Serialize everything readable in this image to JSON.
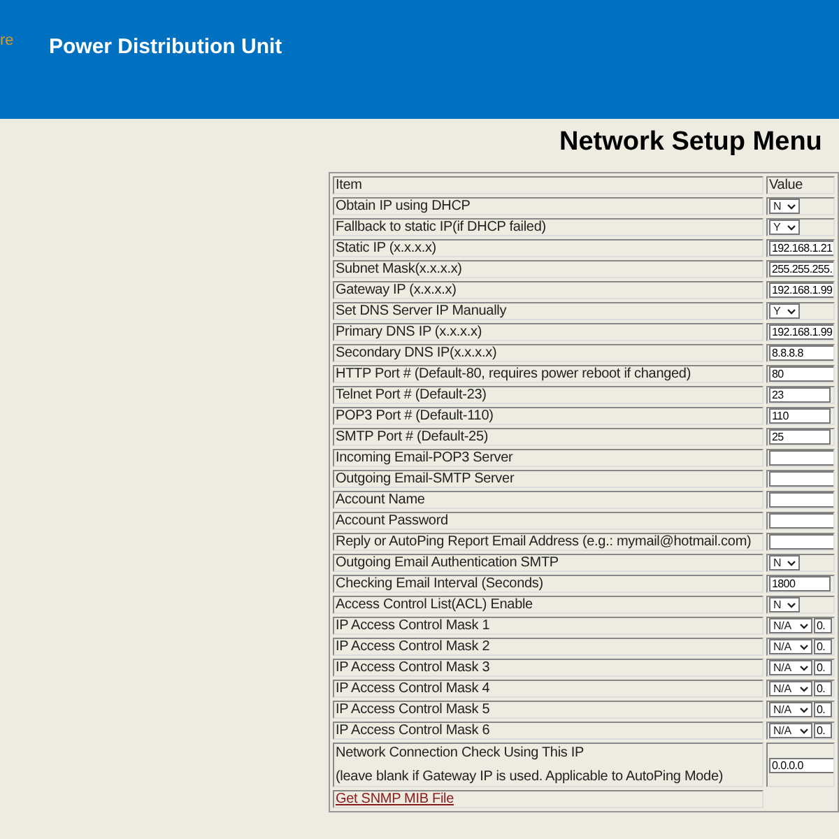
{
  "header": {
    "logo_text": "re",
    "title": "Power Distribution Unit"
  },
  "page_title": "Network Setup Menu",
  "table": {
    "columns": [
      "Item",
      "Value"
    ],
    "rows": [
      {
        "kind": "select",
        "label": "Obtain IP using DHCP",
        "value": "N"
      },
      {
        "kind": "select",
        "label": "Fallback to static IP(if DHCP failed)",
        "value": "Y"
      },
      {
        "kind": "input",
        "label": "Static IP (x.x.x.x)",
        "value": "192.168.1.21"
      },
      {
        "kind": "input",
        "label": "Subnet Mask(x.x.x.x)",
        "value": "255.255.255."
      },
      {
        "kind": "input",
        "label": "Gateway IP (x.x.x.x)",
        "value": "192.168.1.99"
      },
      {
        "kind": "select",
        "label": "Set DNS Server IP Manually",
        "value": "Y"
      },
      {
        "kind": "input",
        "label": "Primary DNS IP (x.x.x.x)",
        "value": "192.168.1.99"
      },
      {
        "kind": "input",
        "label": "Secondary DNS IP(x.x.x.x)",
        "value": "8.8.8.8"
      },
      {
        "kind": "input",
        "label": "HTTP Port # (Default-80, requires power reboot if changed)",
        "value": "80"
      },
      {
        "kind": "short-input",
        "label": "Telnet Port # (Default-23)",
        "value": "23"
      },
      {
        "kind": "short-input",
        "label": "POP3 Port # (Default-110)",
        "value": "110"
      },
      {
        "kind": "short-input",
        "label": "SMTP Port # (Default-25)",
        "value": "25"
      },
      {
        "kind": "input",
        "label": "Incoming Email-POP3 Server"
      },
      {
        "kind": "input",
        "label": "Outgoing Email-SMTP Server"
      },
      {
        "kind": "input",
        "label": "Account Name"
      },
      {
        "kind": "input",
        "label": "Account Password"
      },
      {
        "kind": "input",
        "label": "Reply or AutoPing Report Email Address (e.g.: mymail@hotmail.com)"
      },
      {
        "kind": "select",
        "label": "Outgoing Email Authentication SMTP",
        "value": "N"
      },
      {
        "kind": "short-input",
        "label": "Checking Email Interval (Seconds)",
        "value": "1800"
      },
      {
        "kind": "select",
        "label": "Access Control List(ACL) Enable",
        "value": "N"
      },
      {
        "kind": "acl",
        "label": "IP Access Control Mask 1",
        "value": "N/A",
        "address": "0."
      },
      {
        "kind": "acl",
        "label": "IP Access Control Mask 2",
        "value": "N/A",
        "address": "0."
      },
      {
        "kind": "acl",
        "label": "IP Access Control Mask 3",
        "value": "N/A",
        "address": "0."
      },
      {
        "kind": "acl",
        "label": "IP Access Control Mask 4",
        "value": "N/A",
        "address": "0."
      },
      {
        "kind": "acl",
        "label": "IP Access Control Mask 5",
        "value": "N/A",
        "address": "0."
      },
      {
        "kind": "acl",
        "label": "IP Access Control Mask 6",
        "value": "N/A",
        "address": "0."
      },
      {
        "kind": "check",
        "label": "Network Connection Check Using This IP",
        "note": "(leave blank if Gateway IP is used. Applicable to AutoPing Mode)",
        "value": "0.0.0.0"
      },
      {
        "kind": "link",
        "label": "Get SNMP MIB File"
      }
    ]
  }
}
